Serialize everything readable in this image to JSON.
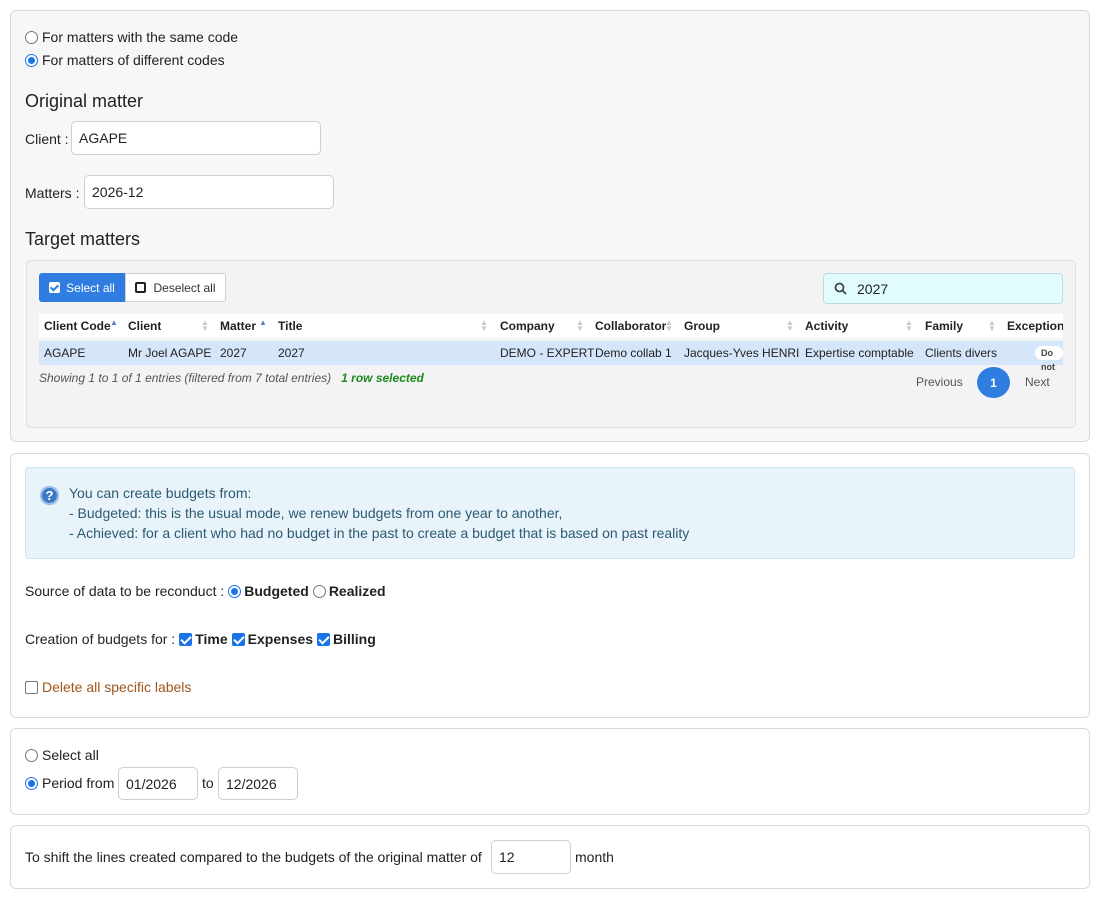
{
  "mode": {
    "same_code": "For matters with the same code",
    "different_codes": "For matters of different codes"
  },
  "original": {
    "heading": "Original matter",
    "client_label": "Client :",
    "client_value": "AGAPE",
    "matters_label": "Matters :",
    "matters_value": "2026-12"
  },
  "target": {
    "heading": "Target matters",
    "select_all": "Select all",
    "deselect_all": "Deselect all",
    "search_value": "2027",
    "columns": [
      "Client Code",
      "Client",
      "Matter",
      "Title",
      "Company",
      "Collaborator",
      "Group",
      "Activity",
      "Family",
      "Exceptional"
    ],
    "rows": [
      [
        "AGAPE",
        "Mr Joel AGAPE",
        "2027",
        "2027",
        "DEMO - EXPERT",
        "Demo collab 1",
        "Jacques-Yves HENRI",
        "Expertise comptable",
        "Clients divers",
        "Do not"
      ]
    ],
    "showing": "Showing 1 to 1 of 1 entries (filtered from 7 total entries)",
    "selected_info": "1 row selected",
    "prev": "Previous",
    "page": "1",
    "next": "Next"
  },
  "info": {
    "line1": "You can create budgets from:",
    "line2": "- Budgeted: this is the usual mode, we renew budgets from one year to another,",
    "line3": "- Achieved: for a client who had no budget in the past to create a budget that is based on past reality"
  },
  "source": {
    "label": "Source of data to be reconduct :",
    "budgeted": "Budgeted",
    "realized": "Realized"
  },
  "creation": {
    "label": "Creation of budgets for :",
    "time": "Time",
    "expenses": "Expenses",
    "billing": "Billing"
  },
  "delete_labels": "Delete all specific labels",
  "period": {
    "select_all": "Select all",
    "from_label": "Period from",
    "from_value": "01/2026",
    "to_label": "to",
    "to_value": "12/2026"
  },
  "shift": {
    "label": "To shift the lines created compared to the budgets of the original matter of",
    "value": "12",
    "unit": "month"
  },
  "colors": {
    "accent": "#2f7de1",
    "selected_row": "#d5e6fb",
    "success": "#1e8a1e",
    "warning_text": "#a0561b"
  }
}
